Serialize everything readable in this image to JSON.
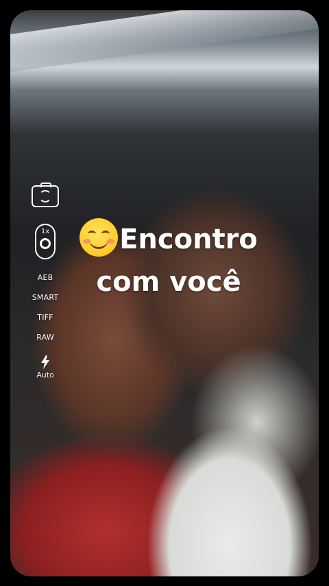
{
  "controls": {
    "rotate_icon": "camera-rotate-icon",
    "zoom_label": "1x",
    "modes": [
      "AEB",
      "SMART",
      "TIFF",
      "RAW"
    ],
    "flash_icon": "flash-icon",
    "flash_label": "Auto"
  },
  "caption": {
    "emoji": "smiling-face-emoji",
    "line1": "Encontro",
    "line2": "com você"
  }
}
